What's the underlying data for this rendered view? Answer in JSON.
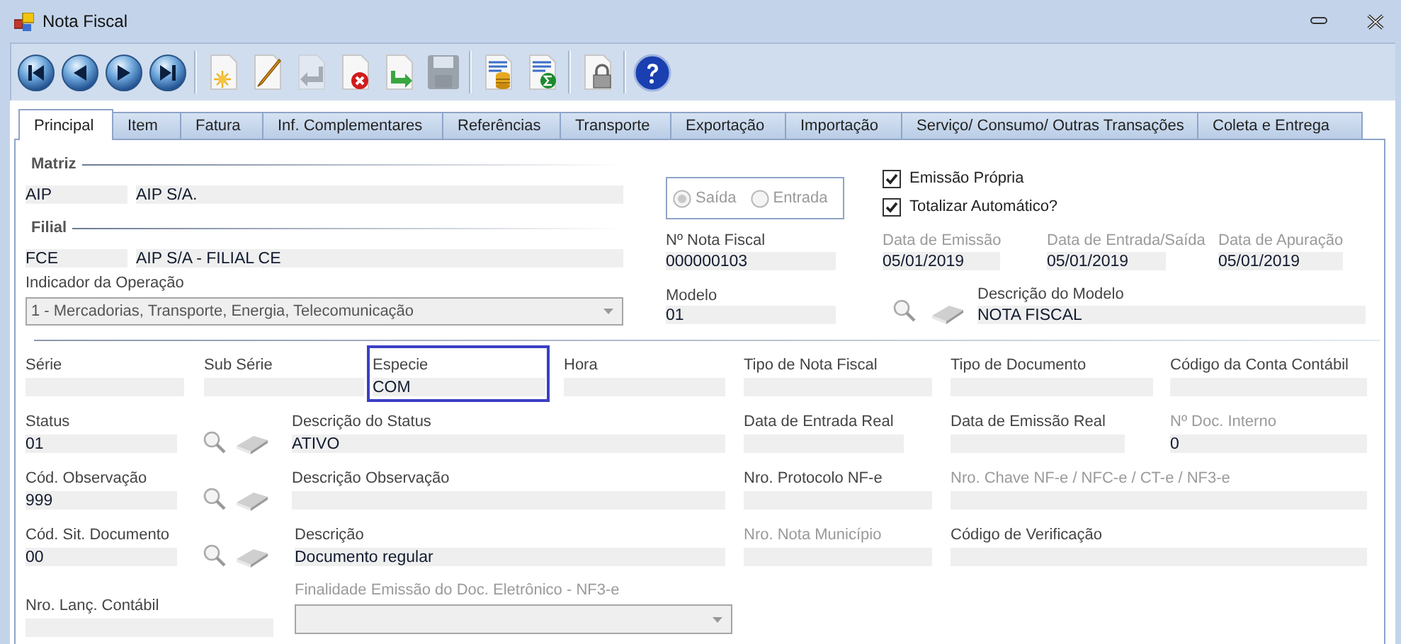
{
  "window": {
    "title": "Nota Fiscal"
  },
  "toolbar": [
    {
      "kind": "first",
      "disabled": false
    },
    {
      "kind": "previous",
      "disabled": false
    },
    {
      "kind": "next",
      "disabled": false
    },
    {
      "kind": "last",
      "disabled": false
    },
    {
      "kind": "separator"
    },
    {
      "kind": "new",
      "disabled": false
    },
    {
      "kind": "edit",
      "disabled": false
    },
    {
      "kind": "undo",
      "disabled": true
    },
    {
      "kind": "delete",
      "disabled": false
    },
    {
      "kind": "export",
      "disabled": false
    },
    {
      "kind": "save",
      "disabled": true
    },
    {
      "kind": "separator"
    },
    {
      "kind": "report-coins",
      "disabled": false
    },
    {
      "kind": "report-sum",
      "disabled": false
    },
    {
      "kind": "separator"
    },
    {
      "kind": "lock",
      "disabled": false
    },
    {
      "kind": "separator"
    },
    {
      "kind": "help",
      "disabled": false
    }
  ],
  "tabs": [
    {
      "label": "Principal",
      "selected": true
    },
    {
      "label": "Item",
      "selected": false
    },
    {
      "label": "Fatura",
      "selected": false
    },
    {
      "label": "Inf. Complementares",
      "selected": false
    },
    {
      "label": "Referências",
      "selected": false
    },
    {
      "label": "Transporte",
      "selected": false
    },
    {
      "label": "Exportação",
      "selected": false
    },
    {
      "label": "Importação",
      "selected": false
    },
    {
      "label": "Serviço/ Consumo/ Outras Transações",
      "selected": false
    },
    {
      "label": "Coleta e Entrega",
      "selected": false
    }
  ],
  "matriz": {
    "title": "Matriz",
    "code": "AIP",
    "name": "AIP S/A."
  },
  "filial": {
    "title": "Filial",
    "code": "FCE",
    "name": "AIP S/A - FILIAL CE"
  },
  "operation": {
    "label": "Indicador da Operação",
    "value": "1 - Mercadorias, Transporte, Energia, Telecomunicação",
    "disabled": true
  },
  "direction": {
    "disabled": true,
    "options": [
      {
        "label": "Saída",
        "selected": true
      },
      {
        "label": "Entrada",
        "selected": false
      }
    ]
  },
  "checks": [
    {
      "label": "Emissão Própria",
      "checked": true
    },
    {
      "label": "Totalizar Automático?",
      "checked": true
    }
  ],
  "numero": {
    "label": "Nº Nota Fiscal",
    "value": "000000103"
  },
  "dates": [
    {
      "label": "Data de Emissão",
      "value": "05/01/2019",
      "disabled": true
    },
    {
      "label": "Data de Entrada/Saída",
      "value": "05/01/2019",
      "disabled": true
    },
    {
      "label": "Data de Apuração",
      "value": "05/01/2019",
      "disabled": true
    }
  ],
  "modelo": {
    "label": "Modelo",
    "value": "01"
  },
  "modelo_descricao": {
    "label": "Descrição do Modelo",
    "value": "NOTA FISCAL"
  },
  "rows": [
    [
      {
        "kind": "text",
        "label": "Série",
        "disabled": false,
        "focused": false
      },
      {
        "kind": "text",
        "label": "Sub Série",
        "disabled": false,
        "focused": false
      },
      {
        "kind": "text",
        "label": "Especie",
        "value": "COM",
        "disabled": false,
        "focused": true
      },
      {
        "kind": "text",
        "label": "Hora",
        "disabled": false,
        "focused": false
      },
      {
        "kind": "text",
        "label": "Tipo de Nota Fiscal",
        "disabled": false,
        "focused": false
      },
      {
        "kind": "text",
        "label": "Tipo de Documento",
        "disabled": false,
        "focused": false
      },
      {
        "kind": "text",
        "label": "Código da Conta Contábil",
        "disabled": false,
        "focused": false
      }
    ],
    [
      {
        "kind": "text",
        "label": "Status",
        "value": "01",
        "disabled": false,
        "focused": false
      },
      {
        "kind": "lookup"
      },
      {
        "kind": "text",
        "label": "Descrição do Status",
        "value": "ATIVO",
        "disabled": false,
        "focused": false
      },
      {
        "kind": "text",
        "label": "Data de Entrada Real",
        "disabled": false,
        "focused": false
      },
      {
        "kind": "text",
        "label": "Data de Emissão Real",
        "disabled": false,
        "focused": false
      },
      {
        "kind": "text",
        "label": "Nº Doc. Interno",
        "value": "0",
        "disabled": true,
        "focused": false
      }
    ],
    [
      {
        "kind": "text",
        "label": "Cód. Observação",
        "value": "999",
        "disabled": false,
        "focused": false
      },
      {
        "kind": "lookup"
      },
      {
        "kind": "text",
        "label": "Descrição Observação",
        "disabled": false,
        "focused": false
      },
      {
        "kind": "text",
        "label": "Nro. Protocolo NF-e",
        "disabled": false,
        "focused": false
      },
      {
        "kind": "text",
        "label": "Nro. Chave NF-e / NFC-e / CT-e / NF3-e",
        "disabled": true,
        "focused": false
      }
    ],
    [
      {
        "kind": "text",
        "label": "Cód. Sit. Documento",
        "value": "00",
        "disabled": false,
        "focused": false
      },
      {
        "kind": "lookup"
      },
      {
        "kind": "text",
        "label": "Descrição",
        "value": "Documento regular",
        "disabled": false,
        "focused": false
      },
      {
        "kind": "text",
        "label": "Nro. Nota Município",
        "disabled": true,
        "focused": false
      },
      {
        "kind": "text",
        "label": "Código de Verificação",
        "disabled": false,
        "focused": false
      }
    ],
    [
      {
        "kind": "text",
        "label": "Nro. Lanç. Contábil",
        "disabled": false,
        "focused": false
      },
      {
        "kind": "combo",
        "label": "Finalidade Emissão do Doc. Eletrônico - NF3-e",
        "disabled": true,
        "focused": false
      }
    ]
  ]
}
